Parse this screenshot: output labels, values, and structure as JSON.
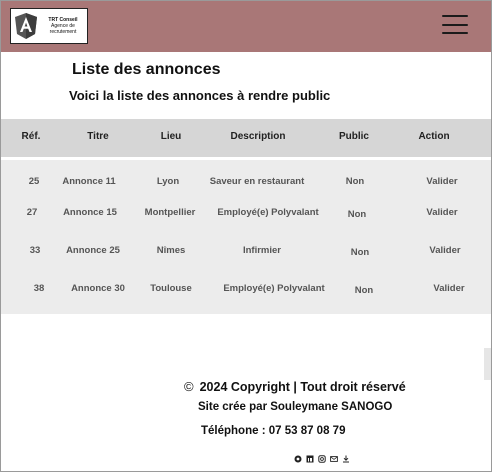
{
  "header": {
    "logo_text": "TRT Conseil",
    "logo_sub": "Agence de recrutement",
    "logo_icon": "angular-shield-icon",
    "menu_icon": "hamburger-menu-icon",
    "background": "#a97777"
  },
  "main": {
    "title": "Liste des annonces",
    "subtitle": "Voici la liste des annonces à rendre public"
  },
  "table": {
    "columns": [
      "Réf.",
      "Titre",
      "Lieu",
      "Description",
      "Public",
      "Action"
    ],
    "rows": [
      {
        "ref": "25",
        "titre": "Annonce 11",
        "lieu": "Lyon",
        "description": "Saveur en restaurant",
        "public": "Non",
        "action": "Valider"
      },
      {
        "ref": "27",
        "titre": "Annonce 15",
        "lieu": "Montpellier",
        "description": "Employé(e) Polyvalant",
        "public": "Non",
        "action": "Valider"
      },
      {
        "ref": "33",
        "titre": "Annonce 25",
        "lieu": "Nîmes",
        "description": "Infirmier",
        "public": "Non",
        "action": "Valider"
      },
      {
        "ref": "38",
        "titre": "Annonce 30",
        "lieu": "Toulouse",
        "description": "Employé(e) Polyvalant",
        "public": "Non",
        "action": "Valider"
      }
    ],
    "header_bg": "#d6d6d6",
    "body_bg": "#ececec"
  },
  "footer": {
    "copyright_icon": "copyright-icon",
    "copyright": "2024 Copyright | Tout droit réservé",
    "credit": "Site crée par Souleymane SANOGO",
    "phone": "Téléphone : 07 53 87 08 79",
    "social_icons": [
      "github-icon",
      "linkedin-icon",
      "instagram-icon",
      "mail-icon",
      "download-icon"
    ]
  }
}
